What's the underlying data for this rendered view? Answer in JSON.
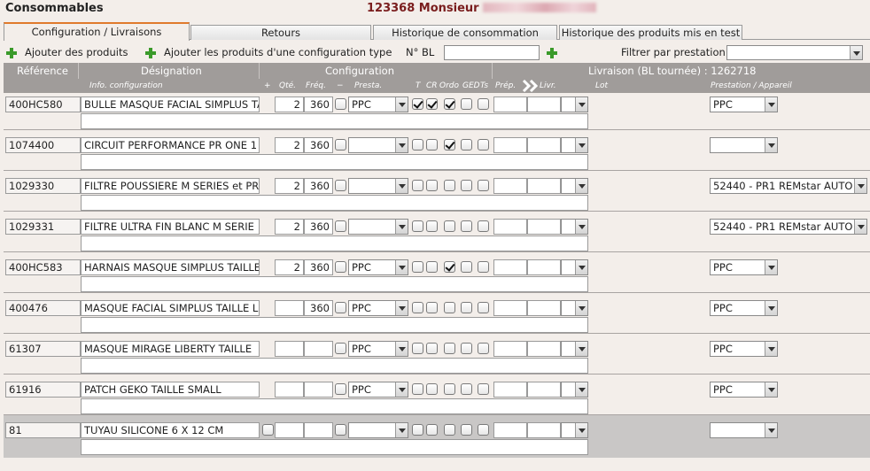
{
  "app_title": "Consommables",
  "patient_title": "123368 Monsieur",
  "tabs": [
    {
      "label": "Configuration / Livraisons",
      "active": true
    },
    {
      "label": "Retours",
      "active": false
    },
    {
      "label": "Historique de consommation",
      "active": false
    },
    {
      "label": "Historique des produits mis en test",
      "active": false
    }
  ],
  "toolbar": {
    "add_products_label": "Ajouter des produits",
    "add_config_type_label": "Ajouter les produits d'une configuration type",
    "bl_label": "N° BL",
    "bl_value": "",
    "filter_label": "Filtrer par prestation",
    "filter_value": ""
  },
  "header": {
    "reference": "Référence",
    "designation": "Désignation",
    "configuration": "Configuration",
    "livraison": "Livraison (BL tournée) : 1262718",
    "info_configuration": "Info. configuration",
    "plus": "+",
    "qte": "Qté.",
    "freq": "Fréq.",
    "minus": "−",
    "presta": "Presta.",
    "t": "T",
    "cr": "CR",
    "ordo": "Ordo",
    "ged": "GED",
    "ts": "Ts",
    "prep": "Prép.",
    "livr": "Livr.",
    "lot": "Lot",
    "prestation_appareil": "Prestation / Appareil"
  },
  "rows": [
    {
      "ref": "400HC580",
      "designation": "BULLE MASQUE FACIAL SIMPLUS TAILLE",
      "qty": "2",
      "freq": "360",
      "presta": "PPC",
      "checks": [
        false,
        true,
        true,
        true,
        false,
        false
      ],
      "prestation": "PPC",
      "extra_check": false
    },
    {
      "ref": "1074400",
      "designation": "CIRCUIT PERFORMANCE PR ONE 1",
      "qty": "2",
      "freq": "360",
      "presta": "",
      "checks": [
        false,
        false,
        false,
        true,
        false,
        false
      ],
      "prestation": "",
      "extra_check": false
    },
    {
      "ref": "1029330",
      "designation": "FILTRE POUSSIERE M SERIES et PR",
      "qty": "2",
      "freq": "360",
      "presta": "",
      "checks": [
        false,
        false,
        false,
        false,
        false,
        false
      ],
      "prestation": "52440 - PR1 REMstar AUTO",
      "extra_check": false
    },
    {
      "ref": "1029331",
      "designation": "FILTRE ULTRA FIN BLANC M SERIE",
      "qty": "2",
      "freq": "360",
      "presta": "",
      "checks": [
        false,
        false,
        false,
        false,
        false,
        false
      ],
      "prestation": "52440 - PR1 REMstar AUTO",
      "extra_check": false
    },
    {
      "ref": "400HC583",
      "designation": "HARNAIS MASQUE SIMPLUS TAILLE",
      "qty": "2",
      "freq": "360",
      "presta": "PPC",
      "checks": [
        false,
        false,
        false,
        true,
        false,
        false
      ],
      "prestation": "PPC",
      "extra_check": false
    },
    {
      "ref": "400476",
      "designation": "MASQUE FACIAL SIMPLUS TAILLE L",
      "qty": "",
      "freq": "360",
      "presta": "PPC",
      "checks": [
        false,
        false,
        false,
        false,
        false,
        false
      ],
      "prestation": "PPC",
      "extra_check": false
    },
    {
      "ref": "61307",
      "designation": "MASQUE MIRAGE LIBERTY TAILLE",
      "qty": "",
      "freq": "",
      "presta": "PPC",
      "checks": [
        false,
        false,
        false,
        false,
        false,
        false
      ],
      "prestation": "PPC",
      "extra_check": false
    },
    {
      "ref": "61916",
      "designation": "PATCH GEKO TAILLE SMALL",
      "qty": "",
      "freq": "",
      "presta": "PPC",
      "checks": [
        false,
        false,
        false,
        false,
        false,
        false
      ],
      "prestation": "PPC",
      "extra_check": false
    },
    {
      "ref": "81",
      "designation": "TUYAU SILICONE 6 X 12 CM",
      "qty": "",
      "freq": "",
      "presta": "",
      "checks": [
        false,
        false,
        false,
        false,
        false,
        false
      ],
      "prestation": "",
      "extra_check": true
    }
  ]
}
